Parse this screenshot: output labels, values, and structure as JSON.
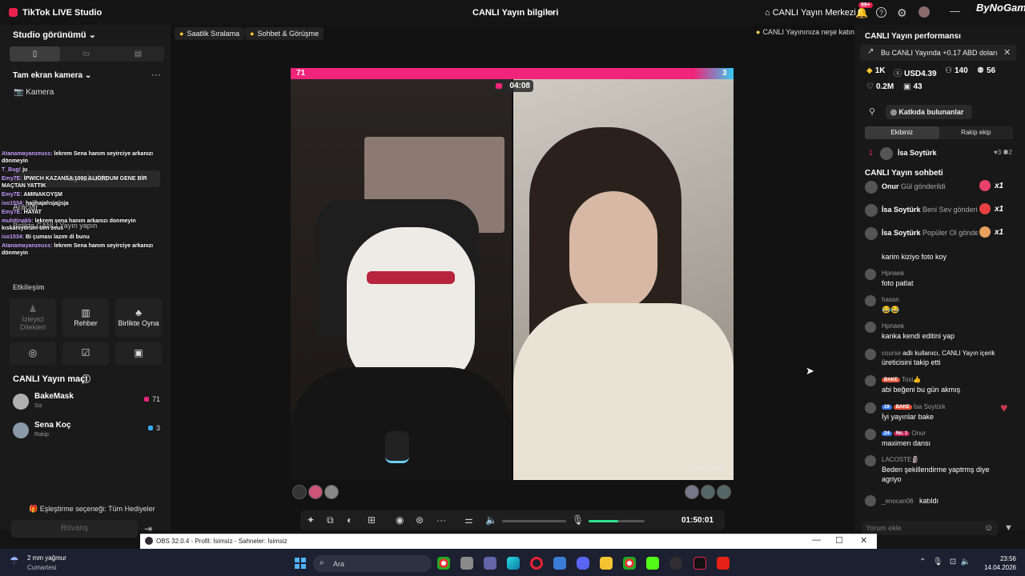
{
  "titlebar": {
    "app_title": "TikTok LIVE Studio",
    "center_title": "CANLI Yayın bilgileri",
    "live_center": "CANLI Yayın Merkezi",
    "notif_count": "99+",
    "watermark": "ByNoGame"
  },
  "left": {
    "studio_view": "Studio görünümü",
    "fullscreen_camera": "Tam ekran kamera",
    "camera": "Kamera",
    "add_source": "Kaynak ekle",
    "tools": "Araçlar",
    "coplay_hint": "Birlikte CANLI Yayın yapın",
    "interaction": "Etkileşim",
    "tiles": {
      "viewer_wishes": "İzleyici Dilekleri",
      "guide": "Rehber",
      "play_together": "Birlikte Oyna"
    },
    "chat_overlay": [
      {
        "user": "Atanamayanzeuss:",
        "text": "lekrem Sena hanım seyirciye arkanızı dönmeyin"
      },
      {
        "user": "T_Bug!",
        "text": "ju"
      },
      {
        "user": "Emy7E:",
        "text": "İPWICH KAZANSA 1000 ALIORDUM GENE BİR MAÇTAN YATTIK"
      },
      {
        "user": "Emy7E:",
        "text": "AMINAKOYŞM"
      },
      {
        "user": "iso1534:",
        "text": "hajjhajahsjajjsja"
      },
      {
        "user": "Emy7E:",
        "text": "HAYAT"
      },
      {
        "user": "muhitinakb:",
        "text": "lekrem sena hanım arkanızı donmeyin kıskanıyorum ben zeus"
      },
      {
        "user": "iso1534:",
        "text": "Bi çuması lazım di bunu"
      },
      {
        "user": "Atanamayanzeuss:",
        "text": "lekrem Sena hanım seyirciye arkanızı dönmeyin"
      }
    ],
    "match": {
      "title": "CANLI Yayın maçı",
      "players": [
        {
          "name": "BakeMask",
          "role": "Siz",
          "score": "71",
          "color": "#f0247a"
        },
        {
          "name": "Sena Koç",
          "role": "Rakip",
          "score": "3",
          "color": "#37a8f2"
        }
      ],
      "gift_option": "Eşleştirme seçeneği: Tüm Hediyeler",
      "rematch": "Rövanş"
    }
  },
  "center": {
    "chips": [
      "Saatlik Sıralama",
      "Sohbet & Görüşme"
    ],
    "hint": "CANLI Yayınınıza neşe katın",
    "score_left": "71",
    "score_right": "3",
    "timer": "04:08",
    "opponent_label": "Sena Koç",
    "elapsed": "01:50:01",
    "mic_level": 0.53
  },
  "right": {
    "perf_title": "CANLI Yayın performansı",
    "earn_banner": "Bu CANLI Yayında +0.17 ABD doları",
    "stats": {
      "likes_k": "1K",
      "usd": "USD4.39",
      "viewers": "140",
      "followers": "56",
      "hearts": "0.2M",
      "gifts": "43"
    },
    "contributors": "Katkıda bulunanlar",
    "tabs": [
      "Ekibiniz",
      "Rakip ekip"
    ],
    "rank": {
      "n": "1",
      "name": "İsa Soytürk",
      "a": "3",
      "b": "2"
    },
    "chat_title": "CANLI Yayın sohbeti",
    "gifts": [
      {
        "user": "Onur",
        "text": "Gül gönderildi",
        "count": "x1",
        "color": "#e8416a"
      },
      {
        "user": "İsa Soytürk",
        "text": "Beni Sev gönderildi",
        "count": "x1",
        "color": "#e84040"
      },
      {
        "user": "İsa Soytürk",
        "text": "Popüler Ol gönderildi",
        "count": "x1",
        "color": "#e8a060"
      }
    ],
    "messages": [
      {
        "user": "",
        "text": "karim kiziyo foto koy"
      },
      {
        "user": "Hpnaeв",
        "text": "foto patlat"
      },
      {
        "user": "hasan",
        "text": "😂😂"
      },
      {
        "user": "Hpnaeв",
        "text": "kanka kendi editini yap"
      },
      {
        "user": "course",
        "text": "adlı kullanıcı, CANLI Yayın içerik",
        "text2": "üreticisini takip etti"
      },
      {
        "user": "Tosi👍",
        "badge": "BAKE",
        "text": "abi beğeni bu gün akmış"
      },
      {
        "user": "İsa Soytürk",
        "badge_lvl": "19",
        "badge": "BAKE",
        "text": "İyi yayınlar bake"
      },
      {
        "user": "Onur",
        "badge_lvl": "24",
        "badge2": "No. 1",
        "text": "maximen dansı"
      },
      {
        "user": "LACOSTE🗿",
        "text": "Beden şekillendirme yaptrmş diye",
        "text2": "agriyo"
      },
      {
        "user": "_enocan06",
        "text": "katıldı"
      }
    ],
    "comment_placeholder": "Yorum ekle"
  },
  "obs": {
    "title": "OBS 32.0.4 - Profil: İsimsiz - Sahneler: İsimsiz"
  },
  "taskbar": {
    "weather": "2 mm yağmur",
    "weather_sub": "Cumartesi",
    "search": "Ara",
    "time": "23:56",
    "date": "14.04.2026"
  }
}
